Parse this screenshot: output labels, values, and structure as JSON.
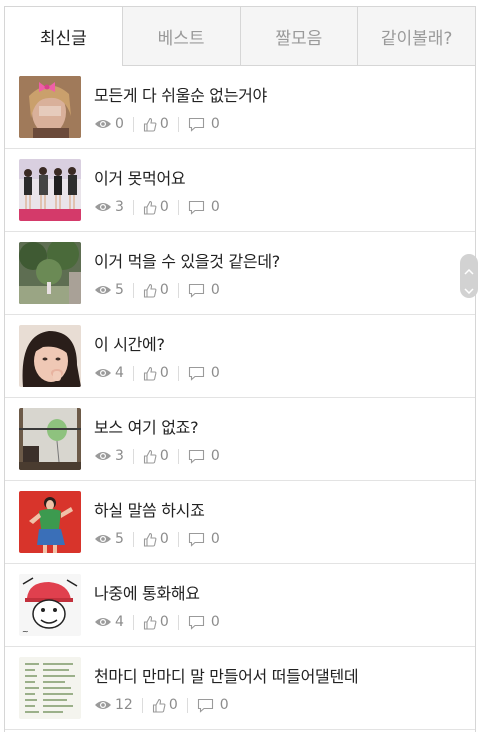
{
  "tabs": [
    {
      "label": "최신글",
      "active": true
    },
    {
      "label": "베스트",
      "active": false
    },
    {
      "label": "짤모음",
      "active": false
    },
    {
      "label": "같이볼래?",
      "active": false
    }
  ],
  "posts": [
    {
      "title": "모든게 다 쉬울순 없는거야",
      "views": "0",
      "likes": "0",
      "comments": "0",
      "thumb": "girl-with-pink-bow"
    },
    {
      "title": "이거 못먹어요",
      "views": "3",
      "likes": "0",
      "comments": "0",
      "thumb": "group-of-women-on-stage"
    },
    {
      "title": "이거 먹을 수 있을것 같은데?",
      "views": "5",
      "likes": "0",
      "comments": "0",
      "thumb": "garden-trees"
    },
    {
      "title": "이 시간에?",
      "views": "4",
      "likes": "0",
      "comments": "0",
      "thumb": "woman-face"
    },
    {
      "title": "보스 여기 없죠?",
      "views": "3",
      "likes": "0",
      "comments": "0",
      "thumb": "green-balloon-room"
    },
    {
      "title": "하실 말씀 하시죠",
      "views": "5",
      "likes": "0",
      "comments": "0",
      "thumb": "woman-red-background"
    },
    {
      "title": "나중에 통화해요",
      "views": "4",
      "likes": "0",
      "comments": "0",
      "thumb": "cartoon-sticker"
    },
    {
      "title": "천마디 만마디 말 만들어서 떠들어댈텐데",
      "views": "12",
      "likes": "0",
      "comments": "0",
      "thumb": "text-document"
    }
  ],
  "icons": {
    "views": "eye-icon",
    "likes": "thumbs-up-icon",
    "comments": "comment-bubble-icon"
  }
}
